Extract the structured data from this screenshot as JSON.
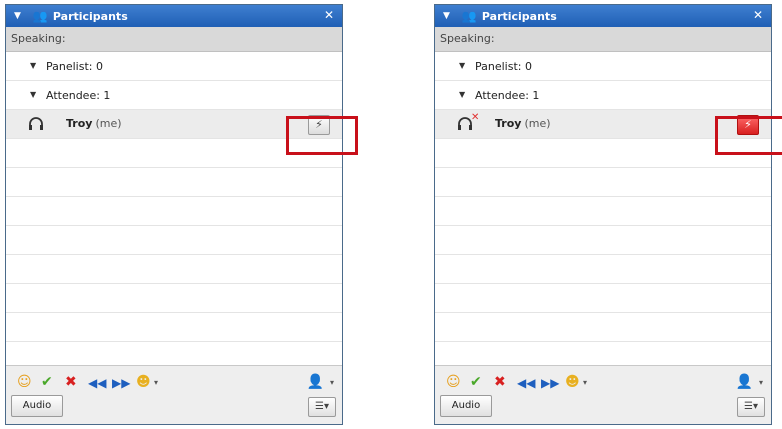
{
  "panels": [
    {
      "title": "Participants",
      "speaking_label": "Speaking:",
      "groups": [
        {
          "label": "Panelist: 0"
        },
        {
          "label": "Attendee: 1"
        }
      ],
      "user": {
        "name": "Troy",
        "suffix": "(me)",
        "muted": false
      },
      "toolbar": {
        "audio_label": "Audio"
      }
    },
    {
      "title": "Participants",
      "speaking_label": "Speaking:",
      "groups": [
        {
          "label": "Panelist: 0"
        },
        {
          "label": "Attendee: 1"
        }
      ],
      "user": {
        "name": "Troy",
        "suffix": "(me)",
        "muted": true
      },
      "toolbar": {
        "audio_label": "Audio"
      }
    }
  ],
  "colors": {
    "titlebar": "#1f5fb5",
    "highlight": "#c8101a",
    "mute_active": "#d82020"
  },
  "icons": {
    "collapse": "triangle-down-icon",
    "participants": "people-icon",
    "close": "close-icon",
    "headset": "headset-icon",
    "mute": "microphone-mute-icon",
    "raise_hand": "raise-hand-icon",
    "yes": "check-icon",
    "no": "x-icon",
    "slower": "rewind-icon",
    "faster": "fast-forward-icon",
    "emoticon": "emoticon-icon",
    "people_menu": "people-menu-icon",
    "list_view": "list-view-icon"
  }
}
